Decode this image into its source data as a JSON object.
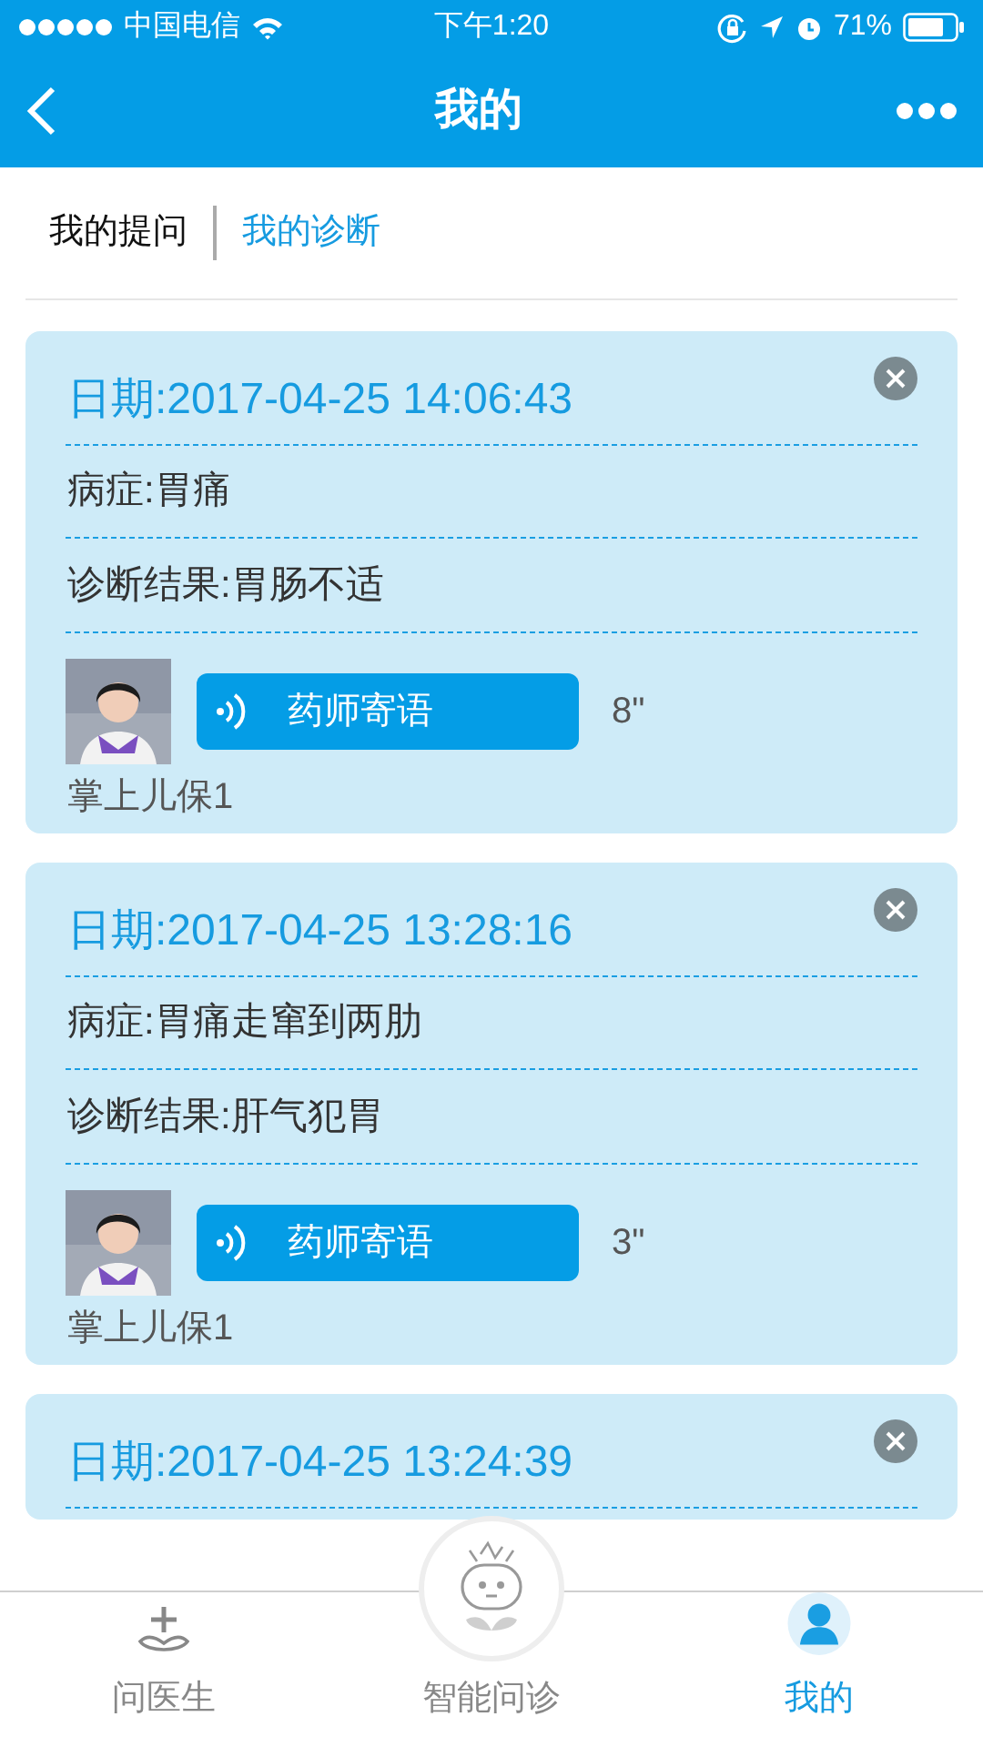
{
  "status_bar": {
    "carrier": "中国电信",
    "time": "下午1:20",
    "battery": "71%"
  },
  "nav": {
    "title": "我的"
  },
  "tabs": [
    {
      "label": "我的提问",
      "selected": false
    },
    {
      "label": "我的诊断",
      "selected": true
    }
  ],
  "records": [
    {
      "date": "日期:2017-04-25 14:06:43",
      "symptom": "病症:胃痛",
      "diagnosis": "诊断结果:胃肠不适",
      "voice_label": "药师寄语",
      "duration": "8\"",
      "doctor": "掌上儿保1"
    },
    {
      "date": "日期:2017-04-25 13:28:16",
      "symptom": "病症:胃痛走窜到两肋",
      "diagnosis": "诊断结果:肝气犯胃",
      "voice_label": "药师寄语",
      "duration": "3\"",
      "doctor": "掌上儿保1"
    },
    {
      "date": "日期:2017-04-25 13:24:39"
    }
  ],
  "tab_bar": [
    {
      "label": "问医生",
      "kind": "doctor",
      "selected": false
    },
    {
      "label": "智能问诊",
      "kind": "robot",
      "selected": false
    },
    {
      "label": "我的",
      "kind": "me",
      "selected": true
    }
  ]
}
